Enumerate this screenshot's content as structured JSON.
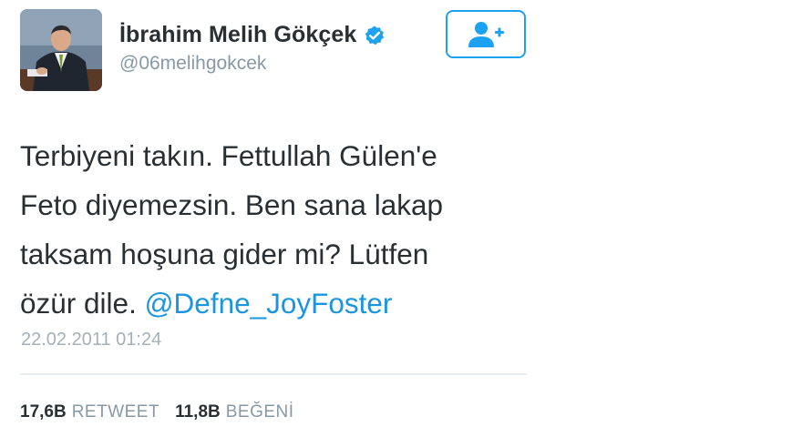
{
  "user": {
    "display_name": "İbrahim Melih Gökçek",
    "handle": "@06melihgokcek",
    "verified": true
  },
  "tweet": {
    "lines": [
      "Terbiyeni takın. Fettullah Gülen'e",
      "Feto diyemezsin. Ben sana lakap",
      "taksam hoşuna gider mi? Lütfen",
      "özür dile. "
    ],
    "mention": "@Defne_JoyFoster",
    "timestamp": "22.02.2011 01:24"
  },
  "stats": {
    "retweet_count": "17,6B",
    "retweet_label": "RETWEET",
    "like_count": "11,8B",
    "like_label": "BEĞENİ"
  },
  "icons": {
    "verified": "verified-badge-icon",
    "follow": "add-user-icon"
  },
  "colors": {
    "accent": "#1da1f2",
    "mention": "#1b95e0",
    "secondary_text": "#8899a6"
  }
}
